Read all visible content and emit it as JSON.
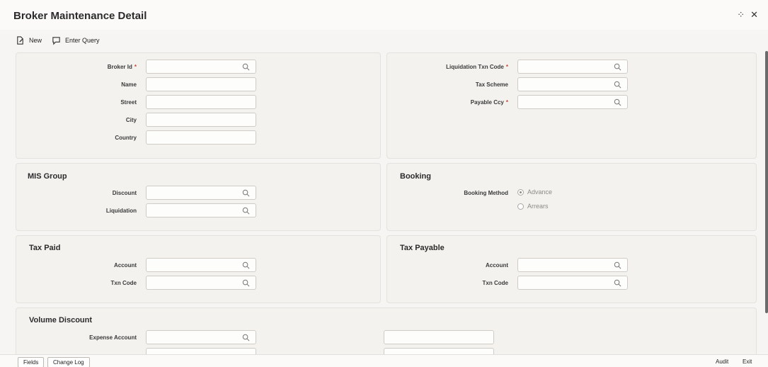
{
  "window": {
    "title": "Broker Maintenance Detail",
    "collapse_glyph": "⁘",
    "close_glyph": "✕"
  },
  "toolbar": {
    "new_label": "New",
    "enter_query_label": "Enter Query"
  },
  "broker": {
    "broker_id_label": "Broker Id",
    "name_label": "Name",
    "street_label": "Street",
    "city_label": "City",
    "country_label": "Country"
  },
  "liquidation": {
    "txn_code_label": "Liquidation Txn Code",
    "tax_scheme_label": "Tax Scheme",
    "payable_ccy_label": "Payable Ccy"
  },
  "mis_group": {
    "title": "MIS Group",
    "discount_label": "Discount",
    "liquidation_label": "Liquidation"
  },
  "booking": {
    "title": "Booking",
    "method_label": "Booking Method",
    "options": [
      "Advance",
      "Arrears"
    ],
    "selected": "Advance"
  },
  "tax_paid": {
    "title": "Tax Paid",
    "account_label": "Account",
    "txn_code_label": "Txn Code"
  },
  "tax_payable": {
    "title": "Tax Payable",
    "account_label": "Account",
    "txn_code_label": "Txn Code"
  },
  "volume_discount": {
    "title": "Volume Discount",
    "expense_account_label": "Expense Account"
  },
  "footer": {
    "fields_label": "Fields",
    "change_log_label": "Change Log",
    "audit_label": "Audit",
    "exit_label": "Exit"
  },
  "required_marker": "*"
}
